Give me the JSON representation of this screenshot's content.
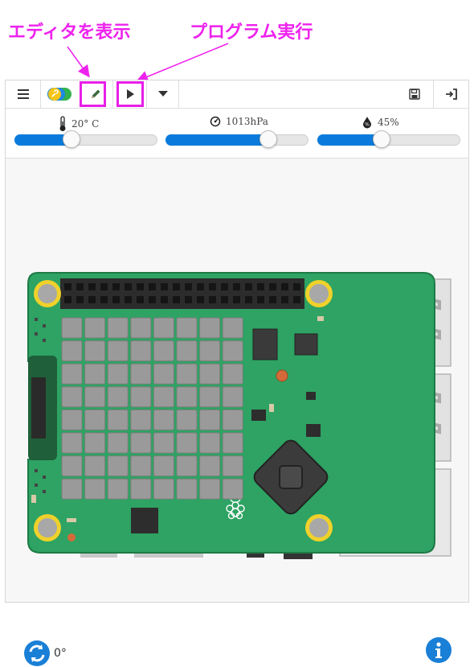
{
  "annotations": {
    "editor_label": "エディタを表示",
    "run_label": "プログラム実行",
    "highlight_color": "#ee22ee"
  },
  "toolbar": {
    "menu_icon": "hamburger-menu-icon",
    "toggle_icon": "mode-toggle-icon",
    "editor_icon": "pencil-icon",
    "run_icon": "play-icon",
    "dropdown_icon": "caret-down-icon",
    "save_icon": "floppy-disk-icon",
    "exit_icon": "sign-in-icon"
  },
  "sensors": {
    "temperature": {
      "icon": "thermometer-icon",
      "value": "20° C",
      "level": 0.4
    },
    "pressure": {
      "icon": "gauge-icon",
      "value": "1013hPa",
      "level": 0.72
    },
    "humidity": {
      "icon": "humidity-drop-icon",
      "value": "45%",
      "level": 0.45
    }
  },
  "board": {
    "name": "Sense HAT",
    "led_rows": 8,
    "led_cols": 8,
    "pcb_color": "#2ea363",
    "led_color": "#9a9a9a"
  },
  "footer": {
    "rotate_icon": "rotate-icon",
    "rotation": "0°",
    "info_icon": "info-icon",
    "accent": "#1a7fd6"
  }
}
